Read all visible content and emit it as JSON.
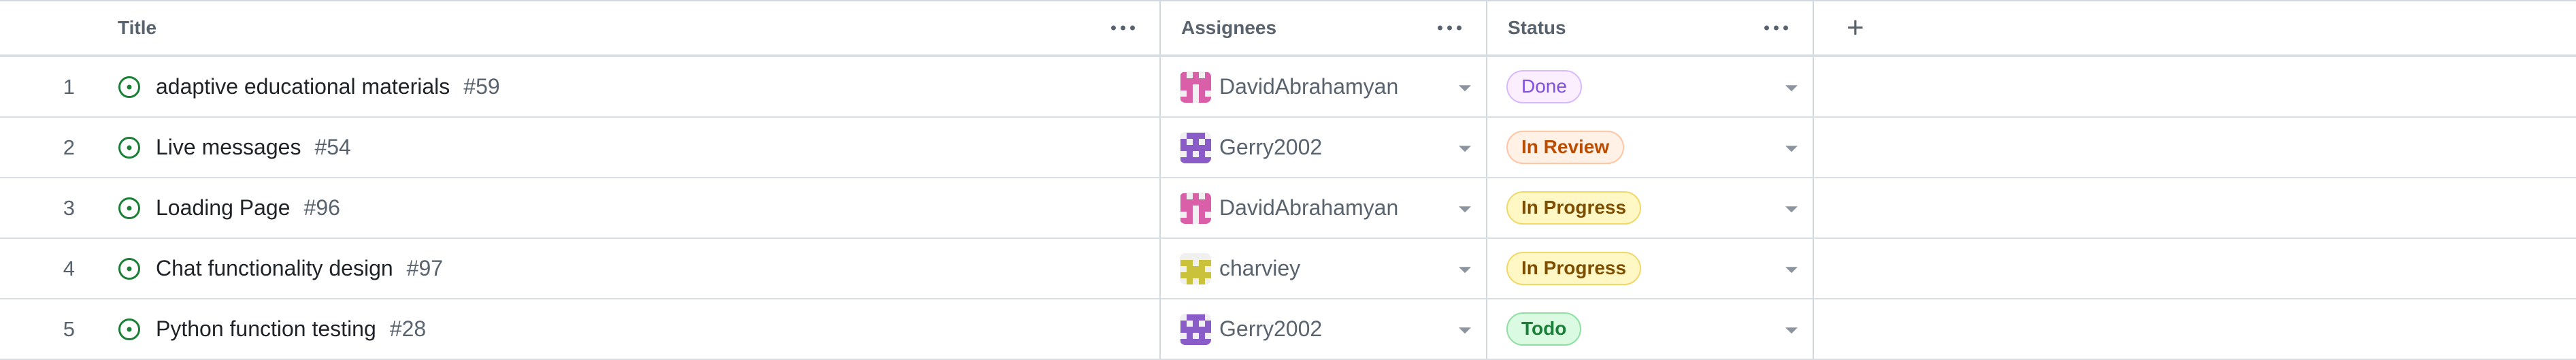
{
  "columns": {
    "title": "Title",
    "assignees": "Assignees",
    "status": "Status",
    "add_column_symbol": "+"
  },
  "rows": [
    {
      "num": "1",
      "title": "adaptive educational materials",
      "issue": "#59",
      "assignee": "DavidAbrahamyan",
      "avatar_color": "#d85fa8",
      "status": "Done",
      "status_kind": "done"
    },
    {
      "num": "2",
      "title": "Live messages",
      "issue": "#54",
      "assignee": "Gerry2002",
      "avatar_color": "#8a5cc8",
      "status": "In Review",
      "status_kind": "review"
    },
    {
      "num": "3",
      "title": "Loading Page",
      "issue": "#96",
      "assignee": "DavidAbrahamyan",
      "avatar_color": "#d85fa8",
      "status": "In Progress",
      "status_kind": "progress"
    },
    {
      "num": "4",
      "title": "Chat functionality design",
      "issue": "#97",
      "assignee": "charviey",
      "avatar_color": "#c9c23a",
      "status": "In Progress",
      "status_kind": "progress"
    },
    {
      "num": "5",
      "title": "Python function testing",
      "issue": "#28",
      "assignee": "Gerry2002",
      "avatar_color": "#8a5cc8",
      "status": "Todo",
      "status_kind": "todo"
    }
  ],
  "colors": {
    "open_issue_green": "#1a7f37",
    "border": "#d0d7de",
    "muted_text": "#59636e"
  },
  "icons": {
    "issue": "issue-opened-icon",
    "menu": "kebab-horizontal-icon",
    "dropdown": "triangle-down-icon",
    "add": "plus-icon"
  }
}
